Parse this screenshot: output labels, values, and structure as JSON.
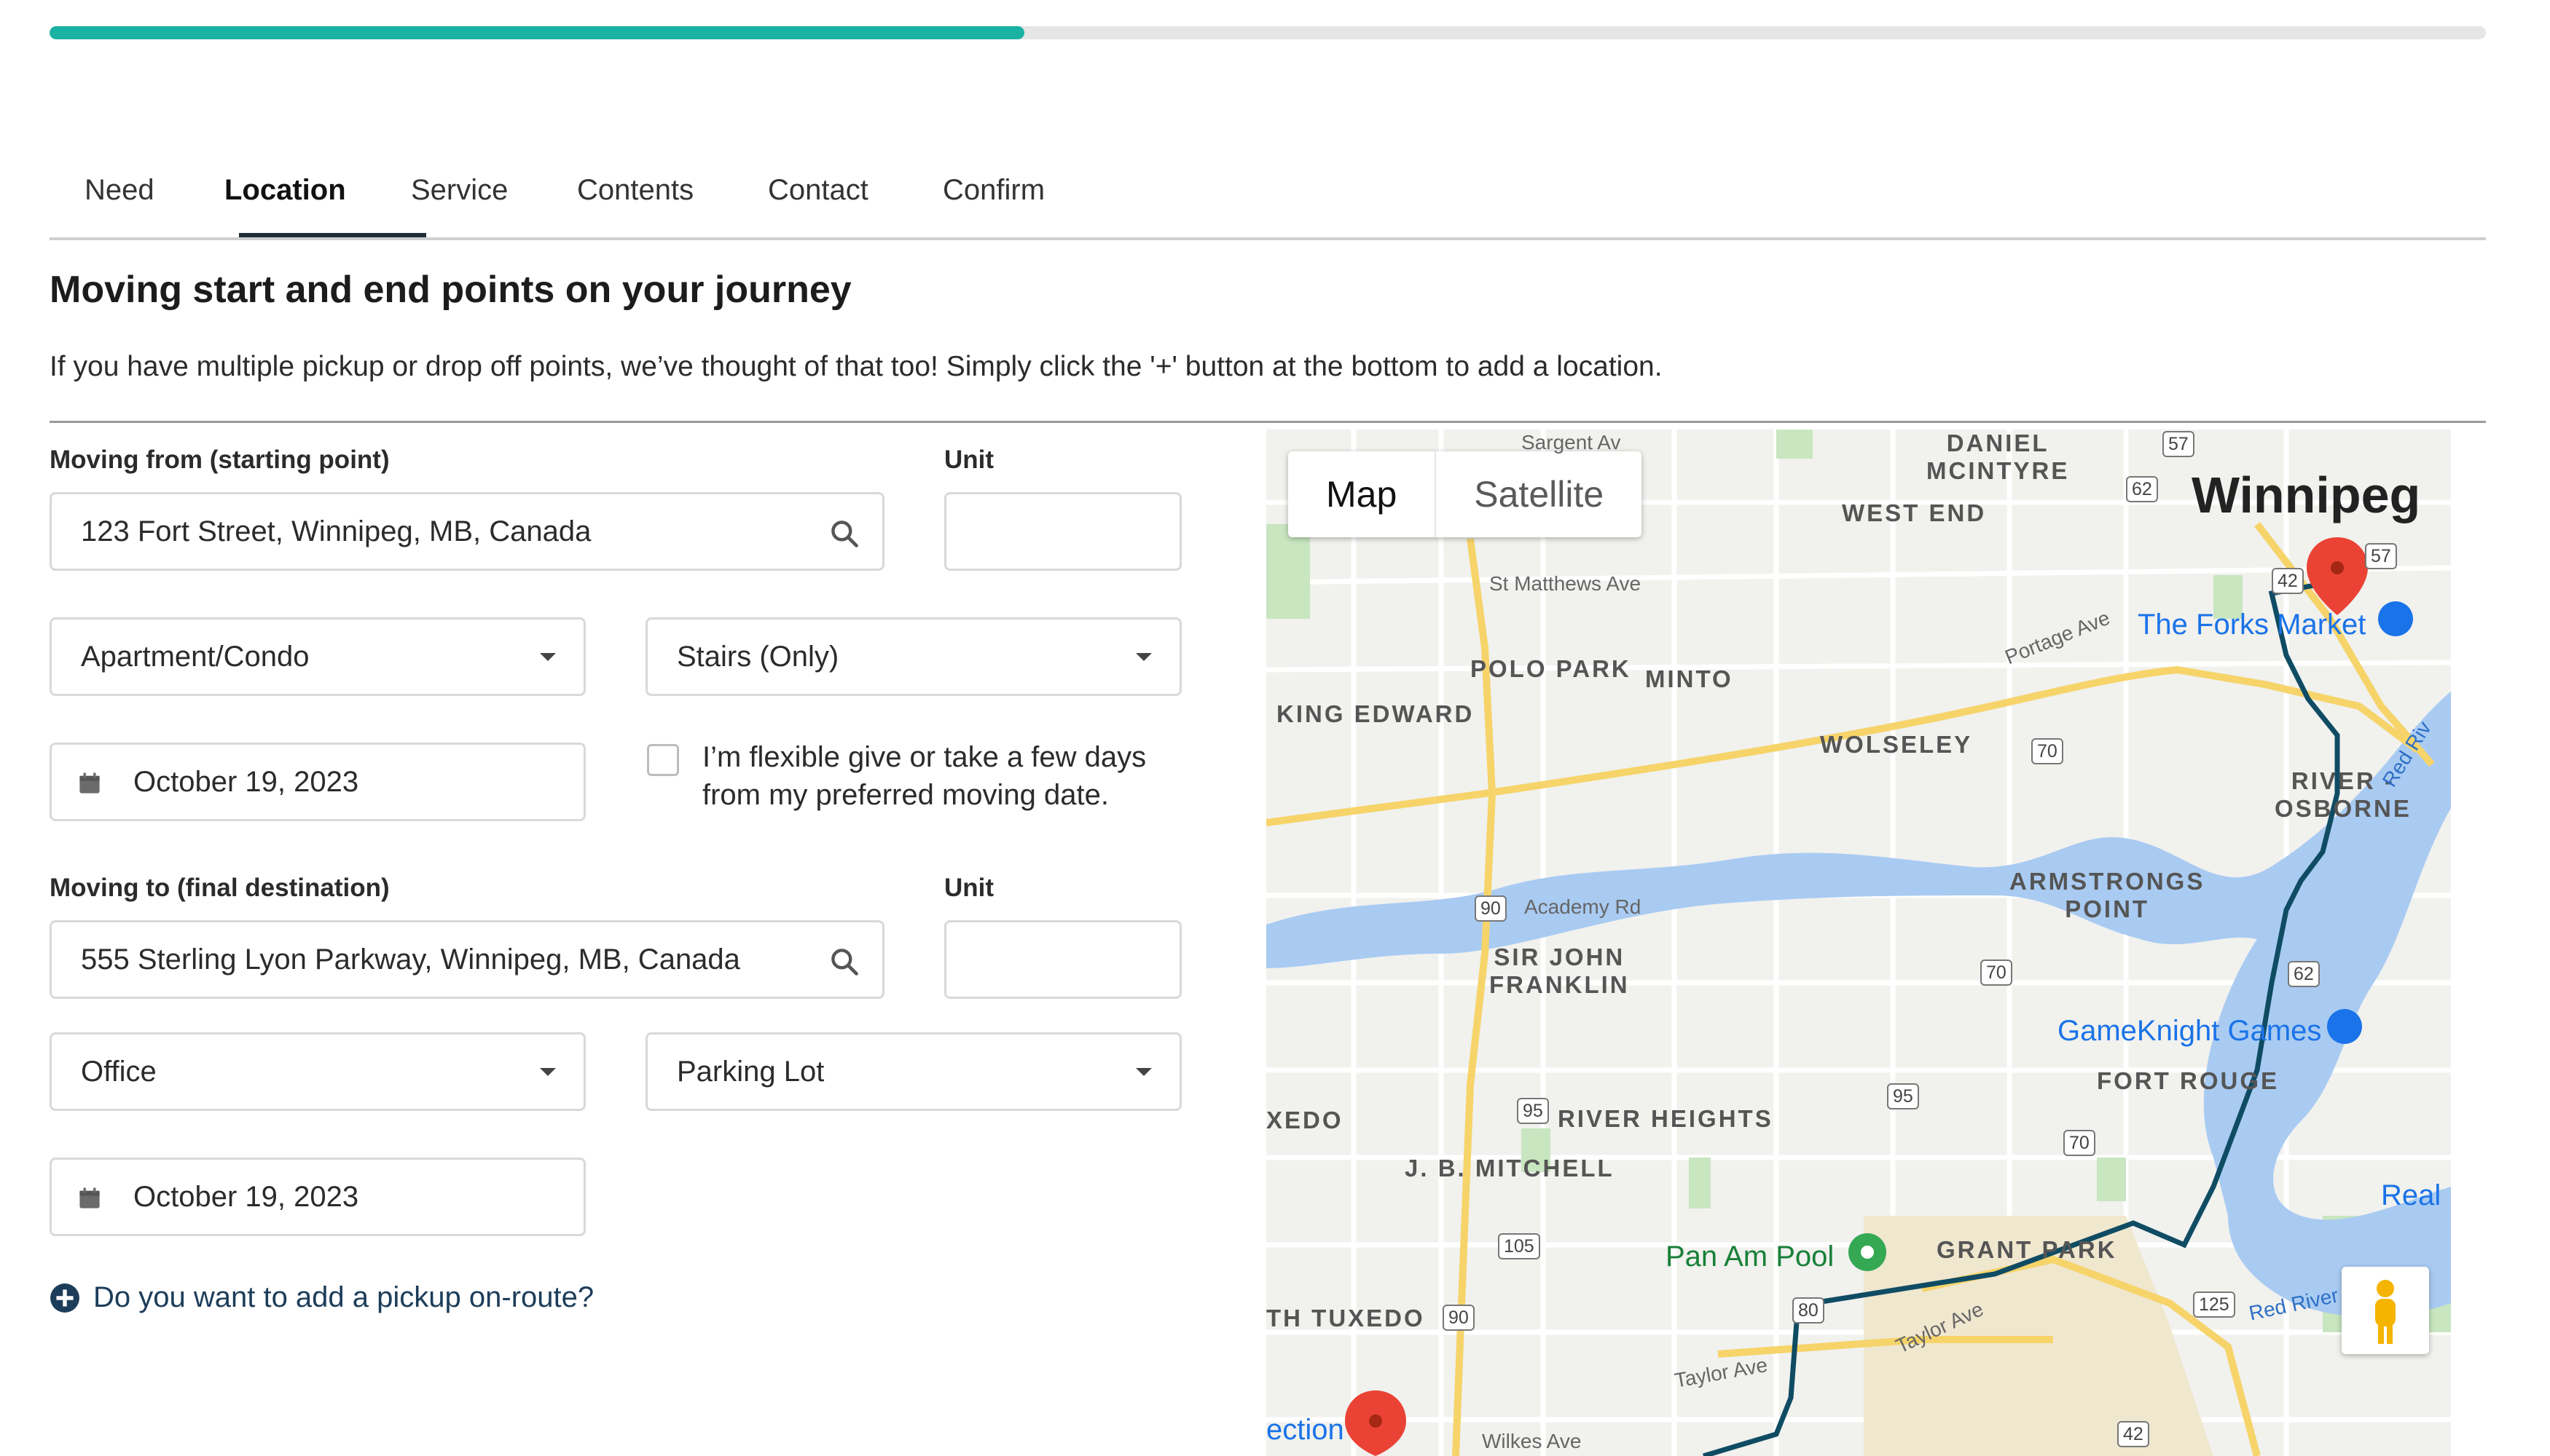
{
  "progress": {
    "fraction": 0.4
  },
  "tabs": [
    "Need",
    "Location",
    "Service",
    "Contents",
    "Contact",
    "Confirm"
  ],
  "heading": "Moving start and end points on your journey",
  "subtext": "If you have multiple pickup or drop off points, we’ve thought of that too! Simply click the '+' button at the bottom to add a location.",
  "from": {
    "label": "Moving from (starting point)",
    "address": "123 Fort Street, Winnipeg, MB, Canada",
    "unit_label": "Unit",
    "unit_value": "",
    "property_type": "Apartment/Condo",
    "access": "Stairs (Only)",
    "date": "October 19, 2023"
  },
  "flexible": {
    "label": "I’m flexible give or take a few days from my preferred moving date.",
    "checked": false
  },
  "to": {
    "label": "Moving to (final destination)",
    "address": "555 Sterling Lyon Parkway, Winnipeg, MB, Canada",
    "unit_label": "Unit",
    "unit_value": "",
    "property_type": "Office",
    "access": "Parking Lot",
    "date": "October 19, 2023"
  },
  "add_pickup": "Do you want to add a pickup on-route?",
  "map": {
    "map_btn": "Map",
    "satellite_btn": "Satellite",
    "city": "Winnipeg",
    "areas": {
      "daniel": "DANIEL\nMCINTYRE",
      "west_end": "WEST END",
      "polo_park": "POLO PARK",
      "minto": "MINTO",
      "king_edward": "KING EDWARD",
      "wolseley": "WOLSELEY",
      "river_osborne": "RIVER -\nOSBORNE",
      "armstrongs": "ARMSTRONGS\nPOINT",
      "sir_john": "SIR JOHN\nFRANKLIN",
      "fort_rouge": "FORT ROUGE",
      "river_heights": "RIVER HEIGHTS",
      "tuxedo_w": "XEDO",
      "jb_mitchell": "J. B. MITCHELL",
      "grant_park": "GRANT PARK",
      "th_tuxedo": "TH TUXEDO"
    },
    "streets": {
      "sargent": "Sargent Av",
      "st_matthews": "St Matthews Ave",
      "portage": "Portage Ave",
      "academy": "Academy Rd",
      "taylor": "Taylor Ave",
      "taylor2": "Taylor Ave",
      "wilkes": "Wilkes Ave",
      "red_river": "Red River",
      "red_riv": "Red Riv"
    },
    "pois": {
      "forks": "The Forks Market",
      "gameknight": "GameKnight Games",
      "pan_am": "Pan Am Pool",
      "real": "Real",
      "ection": "ection"
    },
    "shields": [
      "57",
      "62",
      "42",
      "57",
      "70",
      "90",
      "70",
      "62",
      "95",
      "95",
      "70",
      "105",
      "80",
      "90",
      "125",
      "42"
    ]
  }
}
